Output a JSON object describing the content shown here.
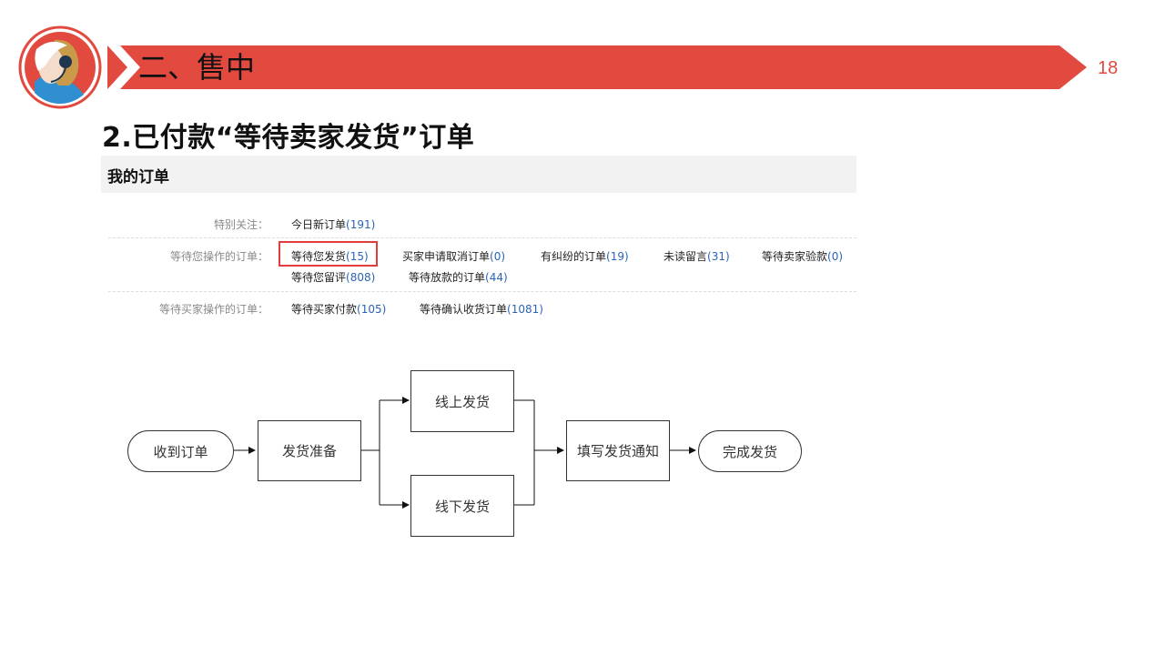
{
  "slide": {
    "title": "二、售中",
    "page_number": "18",
    "accent_color": "#e24a3f",
    "avatar_icon": "customer-service-headset-icon"
  },
  "section": {
    "title": "2.已付款“等待卖家发货”订单"
  },
  "orders_panel": {
    "header": "我的订单",
    "rows": [
      {
        "label": "特别关注：",
        "items": [
          {
            "text": "今日新订单",
            "count": "(191)"
          }
        ]
      },
      {
        "label": "等待您操作的订单：",
        "items": [
          {
            "text": "等待您发货",
            "count": "(15)",
            "highlighted": true
          },
          {
            "text": "买家申请取消订单",
            "count": "(0)"
          },
          {
            "text": "有纠纷的订单",
            "count": "(19)"
          },
          {
            "text": "未读留言",
            "count": "(31)"
          },
          {
            "text": "等待卖家验款",
            "count": "(0)"
          },
          {
            "text": "等待您留评",
            "count": "(808)"
          },
          {
            "text": "等待放款的订单",
            "count": "(44)"
          }
        ]
      },
      {
        "label": "等待买家操作的订单：",
        "items": [
          {
            "text": "等待买家付款",
            "count": "(105)"
          },
          {
            "text": "等待确认收货订单",
            "count": "(1081)"
          }
        ]
      }
    ]
  },
  "flow": {
    "nodes": {
      "start": "收到订单",
      "prepare": "发货准备",
      "online": "线上发货",
      "offline": "线下发货",
      "notify": "填写发货通知",
      "end": "完成发货"
    }
  }
}
